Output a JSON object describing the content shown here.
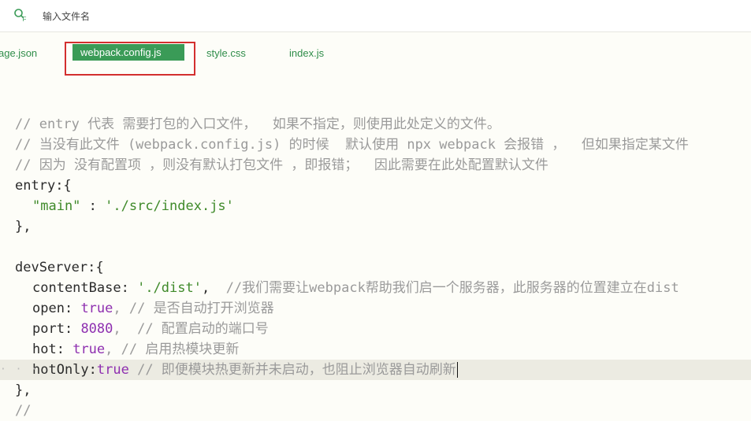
{
  "search": {
    "icon": "search-file-icon",
    "placeholder": "输入文件名"
  },
  "tabs": [
    {
      "label": "age.json",
      "active": false
    },
    {
      "label": "webpack.config.js",
      "active": true
    },
    {
      "label": "style.css",
      "active": false
    },
    {
      "label": "index.js",
      "active": false
    }
  ],
  "colors": {
    "accent": "#3a9b57",
    "highlight_box": "#d32f2f",
    "comment": "#9a9a9a",
    "string": "#3f8a2a",
    "keyword_value": "#8e2fb0"
  },
  "code": {
    "l1": "// entry 代表 需要打包的入口文件，  如果不指定，则使用此处定义的文件。",
    "l2": "// 当没有此文件 (webpack.config.js) 的时候  默认使用 npx webpack 会报错 ，  但如果指定某文件",
    "l3": "// 因为 没有配置项 ，则没有默认打包文件 ，即报错；  因此需要在此处配置默认文件",
    "l4_key": "entry",
    "l4_rest": ":{",
    "l5_key": "\"main\"",
    "l5_sep": " : ",
    "l5_val": "'./src/index.js'",
    "l6": "},",
    "l8_key": "devServer",
    "l8_rest": ":{",
    "l9_key": "contentBase",
    "l9_sep": ": ",
    "l9_val": "'./dist'",
    "l9_comma": ",",
    "l9_comment": "  //我们需要让webpack帮助我们启一个服务器，此服务器的位置建立在dist",
    "l10_key": "open",
    "l10_sep": ": ",
    "l10_val": "true",
    "l10_comment": ", // 是否自动打开浏览器",
    "l11_key": "port",
    "l11_sep": ": ",
    "l11_val": "8080",
    "l11_comment": ",  // 配置启动的端口号",
    "l12_key": "hot",
    "l12_sep": ": ",
    "l12_val": "true",
    "l12_comment": ", // 启用热模块更新",
    "l13_key": "hotOnly",
    "l13_sep": ":",
    "l13_val": "true",
    "l13_comment": " // 即便模块热更新并未启动，也阻止浏览器自动刷新",
    "l14": "},",
    "l15": "//",
    "indent_dots": "· · ·"
  }
}
